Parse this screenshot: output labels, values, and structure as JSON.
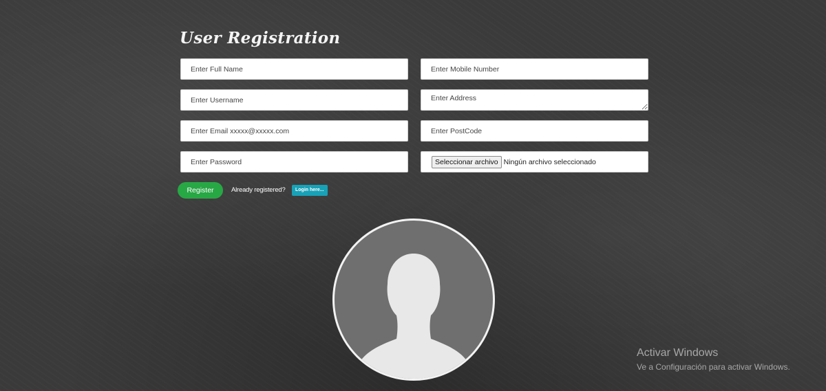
{
  "form": {
    "title": "User Registration",
    "full_name_placeholder": "Enter Full Name",
    "mobile_placeholder": "Enter Mobile Number",
    "username_placeholder": "Enter Username",
    "address_placeholder": "Enter Address",
    "email_placeholder": "Enter Email xxxxx@xxxxx.com",
    "postcode_placeholder": "Enter PostCode",
    "password_placeholder": "Enter Password",
    "file_button_label": "Seleccionar archivo",
    "file_status": "Ningún archivo seleccionado",
    "register_label": "Register",
    "already_registered_text": "Already registered?",
    "login_label": "Login here..."
  },
  "avatar": {
    "icon": "user-silhouette-icon"
  },
  "watermark": {
    "line1": "Activar Windows",
    "line2": "Ve a Configuración para activar Windows."
  },
  "colors": {
    "background": "#3a3a3a",
    "register_button": "#28a745",
    "login_button": "#17a2b8",
    "avatar_fill": "#6f6f6f"
  }
}
